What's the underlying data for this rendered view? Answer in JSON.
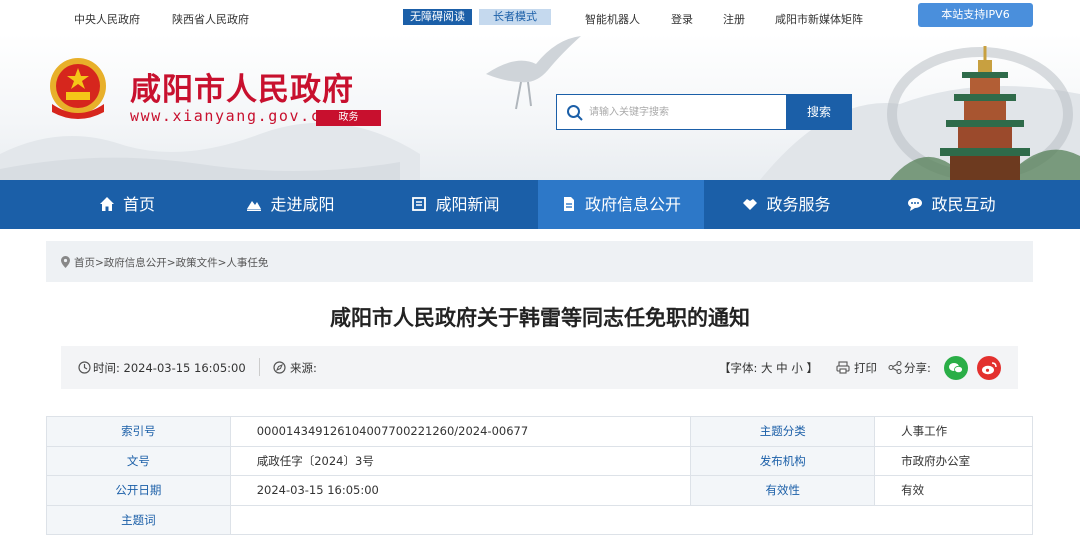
{
  "topbar": {
    "link_central": "中央人民政府",
    "link_province": "陕西省人民政府",
    "accessible_read": "无障碍阅读",
    "elder_mode": "长者模式",
    "robot": "智能机器人",
    "login": "登录",
    "register": "注册",
    "media_matrix": "咸阳市新媒体矩阵",
    "ipv6": "本站支持IPV6"
  },
  "header": {
    "site_title": "咸阳市人民政府",
    "site_url": "www.xianyang.gov.cn",
    "site_tag": "政务",
    "search_placeholder": "请输入关键字搜索",
    "search_button": "搜索"
  },
  "nav": {
    "items": [
      {
        "label": "首页",
        "icon": "home-icon"
      },
      {
        "label": "走进咸阳",
        "icon": "mountain-icon"
      },
      {
        "label": "咸阳新闻",
        "icon": "news-icon"
      },
      {
        "label": "政府信息公开",
        "icon": "document-icon",
        "active": true
      },
      {
        "label": "政务服务",
        "icon": "handshake-icon"
      },
      {
        "label": "政民互动",
        "icon": "chat-icon"
      }
    ]
  },
  "breadcrumb": {
    "text": "首页>政府信息公开>政策文件>人事任免"
  },
  "article": {
    "title": "咸阳市人民政府关于韩雷等同志任免职的通知",
    "time": "时间:  2024-03-15 16:05:00",
    "source": "来源:",
    "font_size": "【字体:  大 中 小 】",
    "print": "打印",
    "share": "分享:"
  },
  "info_table": {
    "rows": [
      {
        "k1": "索引号",
        "v1": "000014349126104007700221260/2024-00677",
        "k2": "主题分类",
        "v2": "人事工作"
      },
      {
        "k1": "文号",
        "v1": "咸政任字〔2024〕3号",
        "k2": "发布机构",
        "v2": "市政府办公室"
      },
      {
        "k1": "公开日期",
        "v1": "2024-03-15 16:05:00",
        "k2": "有效性",
        "v2": "有效"
      },
      {
        "k1": "主题词",
        "v1": "",
        "k2": "",
        "v2": ""
      }
    ]
  },
  "colors": {
    "brand_blue": "#1b5fa8",
    "brand_red": "#c8102e",
    "active_nav": "#2d78c8"
  }
}
